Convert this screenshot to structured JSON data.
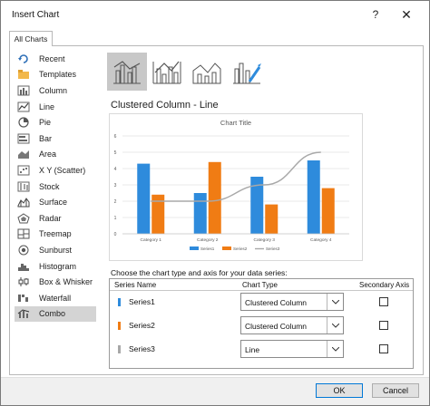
{
  "window": {
    "title": "Insert Chart"
  },
  "tabs": [
    {
      "label": "All Charts"
    }
  ],
  "sidebar": {
    "items": [
      {
        "label": "Recent",
        "icon": "recent-icon"
      },
      {
        "label": "Templates",
        "icon": "templates-icon"
      },
      {
        "label": "Column",
        "icon": "column-chart-icon"
      },
      {
        "label": "Line",
        "icon": "line-chart-icon"
      },
      {
        "label": "Pie",
        "icon": "pie-chart-icon"
      },
      {
        "label": "Bar",
        "icon": "bar-chart-icon"
      },
      {
        "label": "Area",
        "icon": "area-chart-icon"
      },
      {
        "label": "X Y (Scatter)",
        "icon": "scatter-chart-icon"
      },
      {
        "label": "Stock",
        "icon": "stock-chart-icon"
      },
      {
        "label": "Surface",
        "icon": "surface-chart-icon"
      },
      {
        "label": "Radar",
        "icon": "radar-chart-icon"
      },
      {
        "label": "Treemap",
        "icon": "treemap-chart-icon"
      },
      {
        "label": "Sunburst",
        "icon": "sunburst-chart-icon"
      },
      {
        "label": "Histogram",
        "icon": "histogram-chart-icon"
      },
      {
        "label": "Box & Whisker",
        "icon": "box-whisker-chart-icon"
      },
      {
        "label": "Waterfall",
        "icon": "waterfall-chart-icon"
      },
      {
        "label": "Combo",
        "icon": "combo-chart-icon"
      }
    ],
    "selected_index": 16
  },
  "subtypes": [
    {
      "icon": "clustered-column-line-icon",
      "selected": true
    },
    {
      "icon": "clustered-column-line-secondary-axis-icon",
      "selected": false
    },
    {
      "icon": "stacked-area-clustered-column-icon",
      "selected": false
    },
    {
      "icon": "custom-combination-icon",
      "selected": false
    }
  ],
  "chart_heading": "Clustered Column - Line",
  "chart_data": {
    "type": "bar",
    "title": "Chart Title",
    "categories": [
      "Category 1",
      "Category 2",
      "Category 3",
      "Category 4"
    ],
    "ylim": [
      0,
      6
    ],
    "yticks": [
      "0",
      "1",
      "2",
      "3",
      "4",
      "5",
      "6"
    ],
    "grid": true,
    "legend_position": "bottom",
    "series": [
      {
        "name": "Series1",
        "type": "column",
        "values": [
          4.3,
          2.5,
          3.5,
          4.5
        ],
        "color": "#2e8bdc"
      },
      {
        "name": "Series2",
        "type": "column",
        "values": [
          2.4,
          4.4,
          1.8,
          2.8
        ],
        "color": "#f07c14"
      },
      {
        "name": "Series3",
        "type": "line",
        "values": [
          2,
          2,
          3,
          5
        ],
        "color": "#a8a8a8"
      }
    ]
  },
  "series_section": {
    "label": "Choose the chart type and axis for your data series:",
    "headers": {
      "name": "Series Name",
      "type": "Chart Type",
      "axis": "Secondary Axis"
    },
    "rows": [
      {
        "name": "Series1",
        "chart_type": "Clustered Column",
        "secondary_axis": false,
        "color": "#2e8bdc"
      },
      {
        "name": "Series2",
        "chart_type": "Clustered Column",
        "secondary_axis": false,
        "color": "#f07c14"
      },
      {
        "name": "Series3",
        "chart_type": "Line",
        "secondary_axis": false,
        "color": "#a8a8a8"
      }
    ]
  },
  "buttons": {
    "ok": "OK",
    "cancel": "Cancel"
  }
}
